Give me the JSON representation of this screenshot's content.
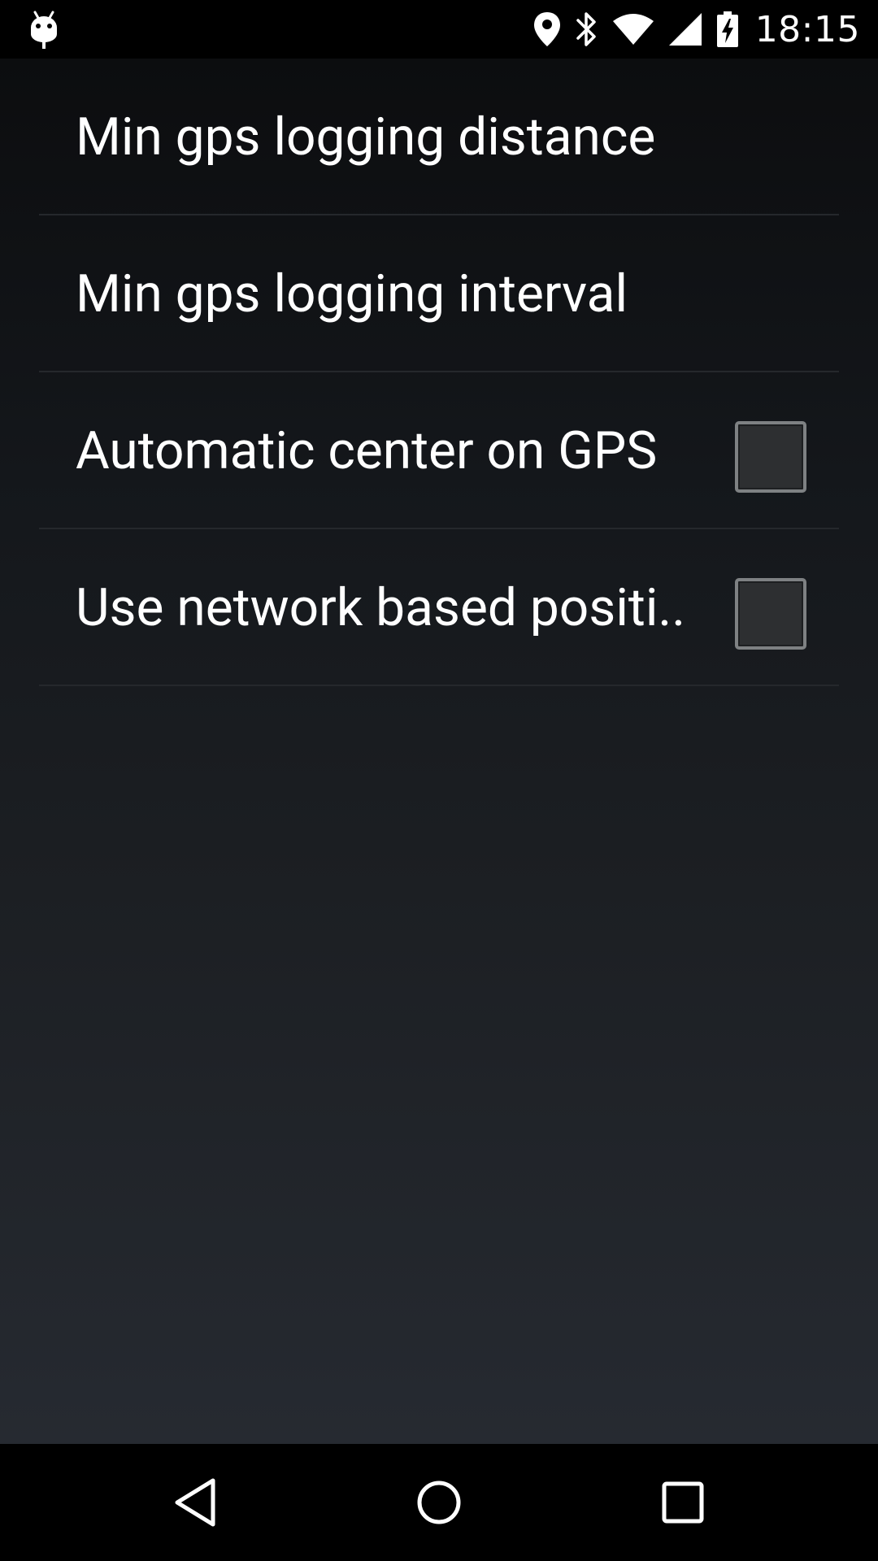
{
  "status_bar": {
    "time": "18:15",
    "icons": {
      "notification": "android-icon",
      "location": "location-icon",
      "bluetooth": "bluetooth-icon",
      "wifi": "wifi-icon",
      "signal": "cell-signal-icon",
      "battery": "battery-charging-icon"
    }
  },
  "preferences": [
    {
      "title": "Min gps logging distance",
      "has_checkbox": false
    },
    {
      "title": "Min gps logging interval",
      "has_checkbox": false
    },
    {
      "title": "Automatic center on GPS",
      "has_checkbox": true,
      "checked": false
    },
    {
      "title": "Use network based positi..",
      "has_checkbox": true,
      "checked": false
    }
  ],
  "nav_bar": {
    "back": "back-icon",
    "home": "home-icon",
    "recents": "recents-icon"
  },
  "colors": {
    "text": "#ffffff",
    "divider": "#25282c",
    "checkbox_border": "#7e8183",
    "checkbox_fill": "#2d2f31"
  }
}
